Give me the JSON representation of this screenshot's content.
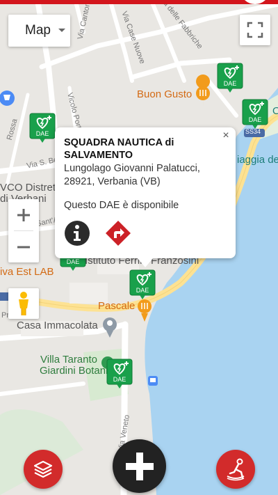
{
  "map": {
    "type_selector": {
      "label": "Map"
    },
    "labels": {
      "buon_gusto": "Buon Gusto",
      "pascale": "Pascale",
      "casa_immacolata": "Casa Immacolata",
      "villa_taranto_1": "Villa Taranto",
      "villa_taranto_2": "Giardini Botanici",
      "spiaggia": "iaggia del",
      "ss34": "SS34",
      "vco_1": "VCO Distrett",
      "vco_2": "di Verbani",
      "rossa": "Rossa",
      "via_s": "Via S. Be",
      "vicolo_porta": "Vicolo Porta",
      "via_cantoni": "Via Canton",
      "via_case_nuove": "Via Case Nuove",
      "via_fabbriche": "Via delle Fabbriche",
      "via_veneto": "Via Veneto",
      "istituto": "Istituto Ferrini Franzosini",
      "viva_est": "iva Est LAB",
      "sant": "Sant'An",
      "pro": "Pro",
      "o_label": "O"
    },
    "markers": [
      {
        "id": "dae-1",
        "text": "DAE"
      },
      {
        "id": "dae-2",
        "text": "DAE"
      },
      {
        "id": "dae-3",
        "text": "DAE"
      },
      {
        "id": "dae-4",
        "text": "DAE"
      },
      {
        "id": "dae-5",
        "text": "DAE"
      },
      {
        "id": "dae-6",
        "text": "DAE"
      }
    ]
  },
  "info_window": {
    "title": "SQUADRA NAUTICA di SALVAMENTO",
    "address_line1": "Lungolago Giovanni Palatucci,",
    "address_line2": "28921, Verbania (VB)",
    "status": "Questo DAE è disponibile",
    "close_glyph": "×"
  },
  "controls": {
    "zoom_in": "+",
    "zoom_out": "−"
  },
  "colors": {
    "brand_red": "#d3151c",
    "fab_red": "#d22b2b",
    "fab_dark": "#222222",
    "marker_green": "#19a04b",
    "water": "#a9d3f1"
  },
  "icons": {
    "layers": "layers-icon",
    "add": "plus-icon",
    "cpr": "cpr-icon",
    "info": "info-icon",
    "directions": "directions-icon",
    "fullscreen": "fullscreen-icon",
    "pegman": "pegman-icon"
  }
}
